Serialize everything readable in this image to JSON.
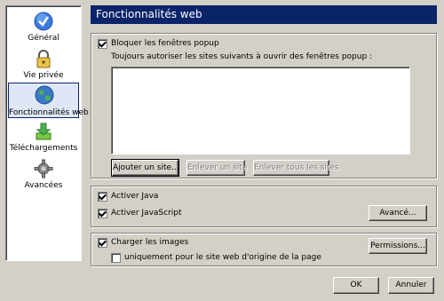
{
  "sidebar": {
    "items": [
      {
        "label": "Général",
        "icon": "checkmark-icon"
      },
      {
        "label": "Vie privée",
        "icon": "lock-icon"
      },
      {
        "label": "Fonctionnalités web",
        "icon": "globe-icon"
      },
      {
        "label": "Téléchargements",
        "icon": "download-icon"
      },
      {
        "label": "Avancées",
        "icon": "gear-icon"
      }
    ],
    "selected_index": 2
  },
  "header": {
    "title": "Fonctionnalités web"
  },
  "popup": {
    "block_label": "Bloquer les fenêtres popup",
    "block_checked": true,
    "allow_label": "Toujours autoriser les sites suivants à ouvrir des fenêtres popup :",
    "add_button": "Ajouter un site...",
    "remove_button": "Enlever un site",
    "remove_all_button": "Enlever tous les sites"
  },
  "java": {
    "java_label": "Activer Java",
    "java_checked": true,
    "js_label": "Activer JavaScript",
    "js_checked": true,
    "advanced_button": "Avancé..."
  },
  "images": {
    "load_label": "Charger les images",
    "load_checked": true,
    "origin_label": "uniquement pour le site web d'origine de la page",
    "origin_checked": false,
    "permissions_button": "Permissions..."
  },
  "footer": {
    "ok": "OK",
    "cancel": "Annuler"
  },
  "colors": {
    "header_bg": "#0a246a",
    "dialog_bg": "#d4d0c8",
    "selected_bg": "#dfe6f5"
  }
}
